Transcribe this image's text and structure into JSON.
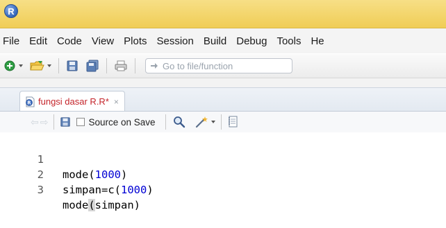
{
  "titlebar": {
    "logo": "R"
  },
  "menubar": {
    "items": [
      "File",
      "Edit",
      "Code",
      "View",
      "Plots",
      "Session",
      "Build",
      "Debug",
      "Tools",
      "He"
    ]
  },
  "toolbar": {
    "goto_placeholder": "Go to file/function",
    "icons": [
      "new-file-icon",
      "open-folder-icon",
      "save-icon",
      "save-all-icon",
      "print-icon",
      "goto-arrow-icon"
    ]
  },
  "editor": {
    "tab": {
      "label": "fungsi dasar R.R*",
      "close": "×"
    },
    "toolbar": {
      "source_on_save_label": "Source on Save",
      "source_on_save_checked": false
    },
    "lines": [
      {
        "n": "1",
        "pre": "mode(",
        "num": "1000",
        "post": ")"
      },
      {
        "n": "2",
        "pre": "simpan=c(",
        "num": "1000",
        "post": ")"
      },
      {
        "n": "3",
        "pre": "mode",
        "paren": "(",
        "rest": "simpan)"
      }
    ]
  },
  "colors": {
    "titlebar": "#f0cd56",
    "tab_label": "#c4242a",
    "code_number": "#0000d4"
  }
}
